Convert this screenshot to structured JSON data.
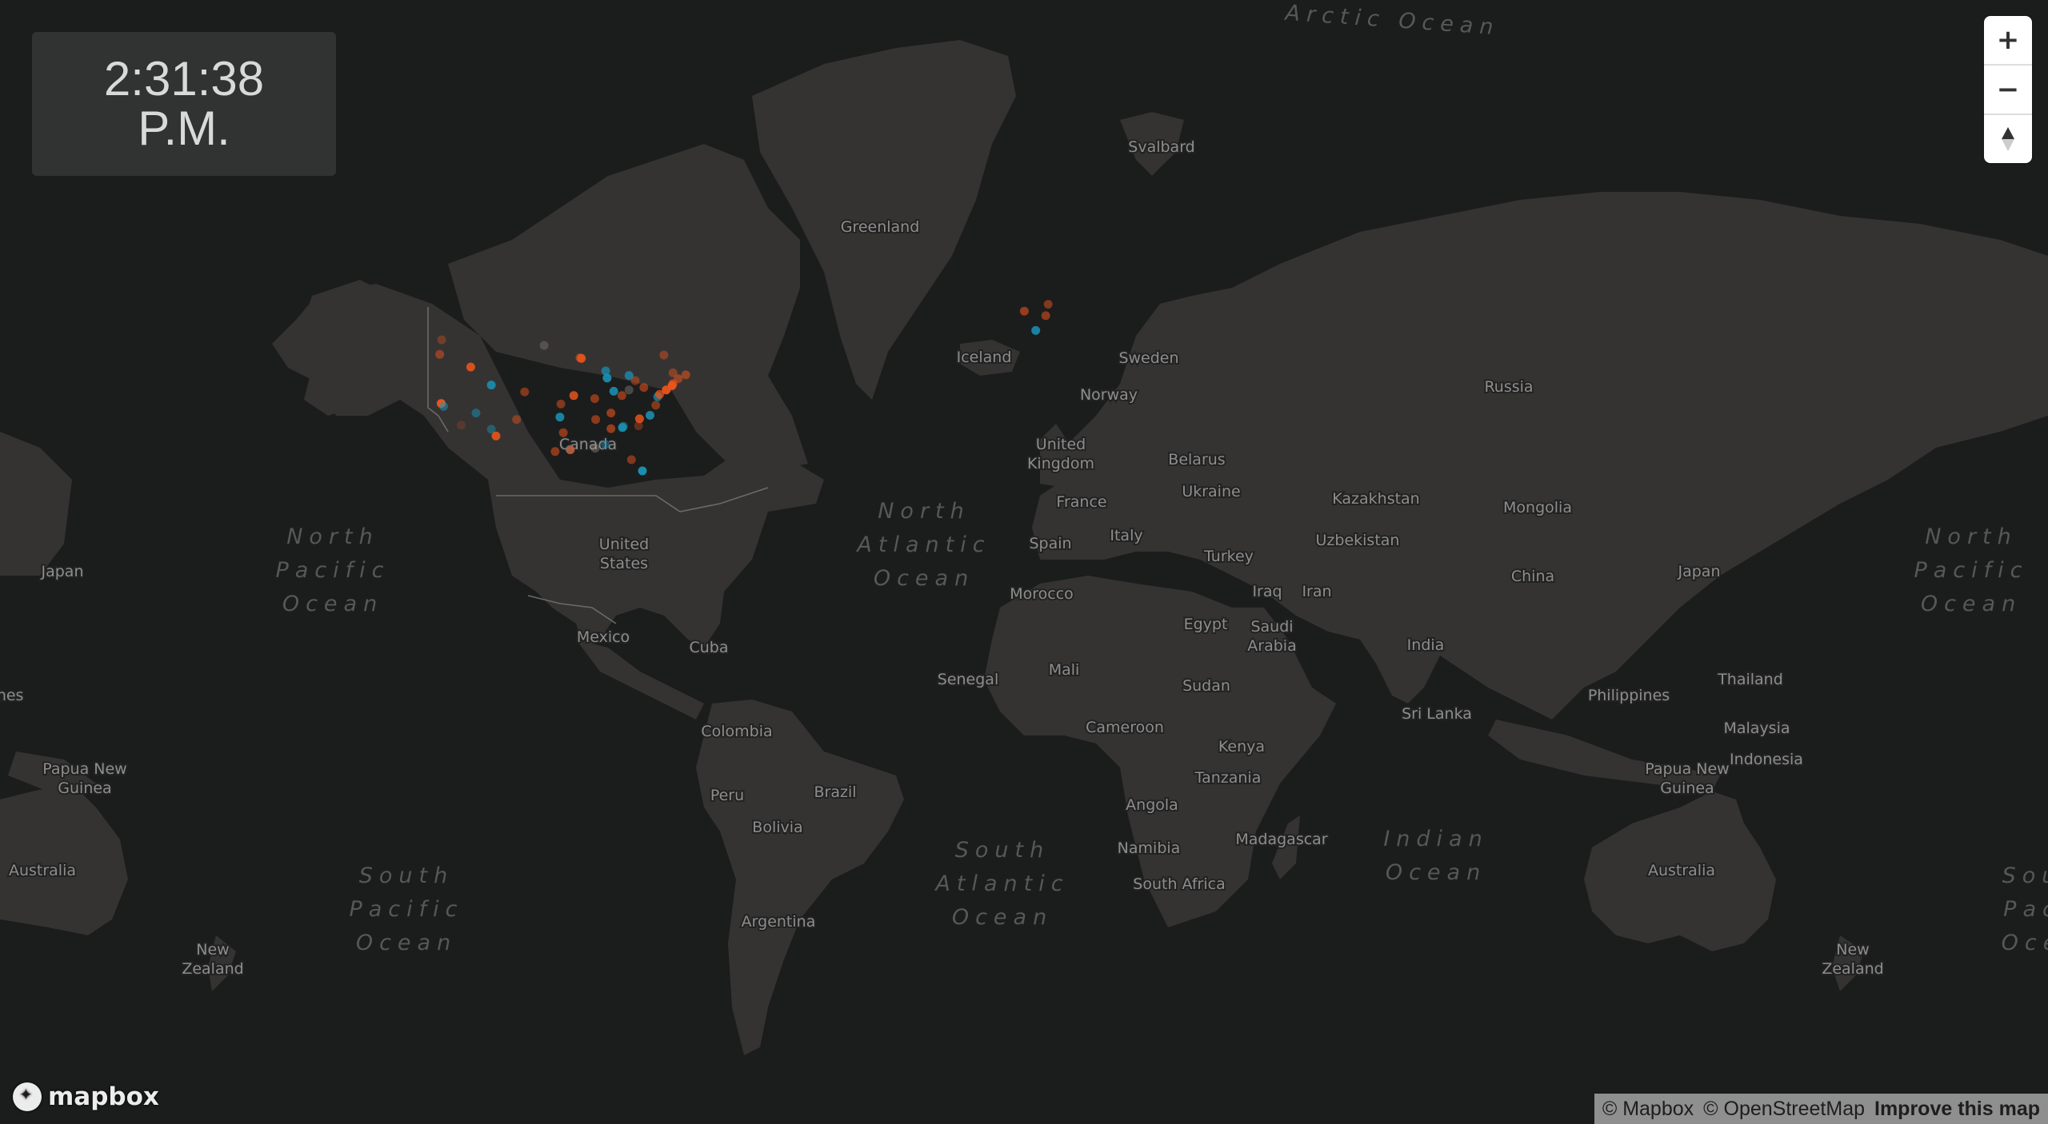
{
  "clock": {
    "time": "2:31:38",
    "period": "P.M."
  },
  "controls": {
    "zoom_in": "+",
    "zoom_out": "−",
    "compass_icon": "compass-north-arrow"
  },
  "logo": {
    "text": "mapbox",
    "icon": "mapbox-logo-icon"
  },
  "attribution": {
    "mapbox": "© Mapbox",
    "osm": "© OpenStreetMap",
    "improve": "Improve this map"
  },
  "colors": {
    "background": "#1b1c1c",
    "land": "#343332",
    "dot_orange": "#e8541c",
    "dot_blue": "#1a93b8"
  },
  "place_labels": [
    [
      "Greenland"
    ],
    [
      "Svalbard"
    ],
    [
      "Iceland"
    ],
    [
      "Sweden"
    ],
    [
      "Norway"
    ],
    [
      "Canada"
    ],
    [
      "United",
      "Kingdom"
    ],
    [
      "Belarus"
    ],
    [
      "Russia"
    ],
    [
      "Ukraine"
    ],
    [
      "France"
    ],
    [
      "Kazakhstan"
    ],
    [
      "Mongolia"
    ],
    [
      "Italy"
    ],
    [
      "Spain"
    ],
    [
      "Uzbekistan"
    ],
    [
      "Turkey"
    ],
    [
      "United",
      "States"
    ],
    [
      "Japan"
    ],
    [
      "Japan"
    ],
    [
      "China"
    ],
    [
      "Iraq"
    ],
    [
      "Iran"
    ],
    [
      "Morocco"
    ],
    [
      "Egypt"
    ],
    [
      "Saudi",
      "Arabia"
    ],
    [
      "Mexico"
    ],
    [
      "India"
    ],
    [
      "Cuba"
    ],
    [
      "Thailand"
    ],
    [
      "Mali"
    ],
    [
      "Senegal"
    ],
    [
      "Sudan"
    ],
    [
      "Philippines"
    ],
    [
      "ines"
    ],
    [
      "Sri Lanka"
    ],
    [
      "Cameroon"
    ],
    [
      "Malaysia"
    ],
    [
      "Colombia"
    ],
    [
      "Kenya"
    ],
    [
      "Indonesia"
    ],
    [
      "Papua New",
      "Guinea"
    ],
    [
      "Papua New",
      "Guinea"
    ],
    [
      "Tanzania"
    ],
    [
      "Brazil"
    ],
    [
      "Peru"
    ],
    [
      "Bolivia"
    ],
    [
      "Angola"
    ],
    [
      "Madagascar"
    ],
    [
      "Namibia"
    ],
    [
      "Australia"
    ],
    [
      "Australia"
    ],
    [
      "South Africa"
    ],
    [
      "Argentina"
    ],
    [
      "New",
      "Zealand"
    ],
    [
      "New",
      "Zealand"
    ]
  ],
  "ocean_labels": [
    [
      "Arctic Ocean"
    ],
    [
      "North",
      "Pacific",
      "Ocean"
    ],
    [
      "North",
      "Atlantic",
      "Ocean"
    ],
    [
      "North",
      "Pacific",
      "Ocean"
    ],
    [
      "South",
      "Pacific",
      "Ocean"
    ],
    [
      "South",
      "Atlantic",
      "Ocean"
    ],
    [
      "Indian",
      "Ocean"
    ],
    [
      "Sou",
      "Pac",
      "Oce"
    ]
  ],
  "data_points": {
    "legend_note": "Orange and blue markers at US and European locations",
    "points": [
      {
        "lon": -122.7,
        "lat": 45.5,
        "color": "orange",
        "opacity": 0.5
      },
      {
        "lon": -122.3,
        "lat": 47.6,
        "color": "orange",
        "opacity": 0.35
      },
      {
        "lon": -116.2,
        "lat": 43.6,
        "color": "orange",
        "opacity": 0.9
      },
      {
        "lon": -122.4,
        "lat": 37.8,
        "color": "orange",
        "opacity": 1.0
      },
      {
        "lon": -118.2,
        "lat": 34.1,
        "color": "orange",
        "opacity": 0.2
      },
      {
        "lon": -121.9,
        "lat": 37.3,
        "color": "blue",
        "opacity": 0.55
      },
      {
        "lon": -111.9,
        "lat": 40.8,
        "color": "blue",
        "opacity": 0.85
      },
      {
        "lon": -115.1,
        "lat": 36.2,
        "color": "blue",
        "opacity": 0.5
      },
      {
        "lon": -111.9,
        "lat": 33.4,
        "color": "blue",
        "opacity": 0.45
      },
      {
        "lon": -110.9,
        "lat": 32.2,
        "color": "orange",
        "opacity": 0.9
      },
      {
        "lon": -106.6,
        "lat": 35.1,
        "color": "orange",
        "opacity": 0.45
      },
      {
        "lon": -104.9,
        "lat": 39.7,
        "color": "orange",
        "opacity": 0.5
      },
      {
        "lon": -100.8,
        "lat": 46.8,
        "color": "white",
        "opacity": 0.25
      },
      {
        "lon": -93.3,
        "lat": 45.0,
        "color": "orange",
        "opacity": 0.5
      },
      {
        "lon": -93.0,
        "lat": 44.9,
        "color": "orange",
        "opacity": 0.9
      },
      {
        "lon": -97.3,
        "lat": 37.7,
        "color": "orange",
        "opacity": 0.5
      },
      {
        "lon": -94.6,
        "lat": 39.1,
        "color": "orange",
        "opacity": 0.85
      },
      {
        "lon": -90.2,
        "lat": 38.6,
        "color": "orange",
        "opacity": 0.55
      },
      {
        "lon": -87.6,
        "lat": 41.9,
        "color": "blue",
        "opacity": 0.9
      },
      {
        "lon": -87.9,
        "lat": 43.0,
        "color": "blue",
        "opacity": 0.7
      },
      {
        "lon": -83.0,
        "lat": 42.3,
        "color": "blue",
        "opacity": 0.75
      },
      {
        "lon": -86.2,
        "lat": 39.8,
        "color": "blue",
        "opacity": 0.85
      },
      {
        "lon": -81.7,
        "lat": 41.5,
        "color": "orange",
        "opacity": 0.45
      },
      {
        "lon": -84.5,
        "lat": 39.1,
        "color": "orange",
        "opacity": 0.55
      },
      {
        "lon": -97.5,
        "lat": 35.5,
        "color": "blue",
        "opacity": 0.85
      },
      {
        "lon": -96.8,
        "lat": 32.8,
        "color": "orange",
        "opacity": 0.55
      },
      {
        "lon": -95.4,
        "lat": 29.8,
        "color": "blue",
        "opacity": 0.7
      },
      {
        "lon": -95.3,
        "lat": 29.7,
        "color": "orange",
        "opacity": 0.7
      },
      {
        "lon": -98.5,
        "lat": 29.4,
        "color": "orange",
        "opacity": 0.55
      },
      {
        "lon": -90.1,
        "lat": 30.0,
        "color": "white",
        "opacity": 0.3
      },
      {
        "lon": -90.0,
        "lat": 35.1,
        "color": "orange",
        "opacity": 0.55
      },
      {
        "lon": -86.8,
        "lat": 36.2,
        "color": "orange",
        "opacity": 0.6
      },
      {
        "lon": -86.8,
        "lat": 33.5,
        "color": "orange",
        "opacity": 0.6
      },
      {
        "lon": -84.4,
        "lat": 33.7,
        "color": "blue",
        "opacity": 0.85
      },
      {
        "lon": -84.2,
        "lat": 33.9,
        "color": "blue",
        "opacity": 0.55
      },
      {
        "lon": -82.5,
        "lat": 27.9,
        "color": "orange",
        "opacity": 0.5
      },
      {
        "lon": -80.2,
        "lat": 25.8,
        "color": "blue",
        "opacity": 0.95
      },
      {
        "lon": -88.0,
        "lat": 30.7,
        "color": "blue",
        "opacity": 0.45
      },
      {
        "lon": -80.8,
        "lat": 35.2,
        "color": "orange",
        "opacity": 0.85
      },
      {
        "lon": -81.0,
        "lat": 34.0,
        "color": "orange",
        "opacity": 0.35
      },
      {
        "lon": -78.6,
        "lat": 35.8,
        "color": "blue",
        "opacity": 0.85
      },
      {
        "lon": -77.4,
        "lat": 37.5,
        "color": "orange",
        "opacity": 0.5
      },
      {
        "lon": -77.0,
        "lat": 38.9,
        "color": "blue",
        "opacity": 0.7
      },
      {
        "lon": -76.6,
        "lat": 39.3,
        "color": "orange",
        "opacity": 0.75
      },
      {
        "lon": -75.2,
        "lat": 40.0,
        "color": "orange",
        "opacity": 0.95
      },
      {
        "lon": -74.0,
        "lat": 40.7,
        "color": "orange",
        "opacity": 1.0
      },
      {
        "lon": -73.8,
        "lat": 41.0,
        "color": "orange",
        "opacity": 0.7
      },
      {
        "lon": -72.7,
        "lat": 41.8,
        "color": "orange",
        "opacity": 0.55
      },
      {
        "lon": -71.1,
        "lat": 42.4,
        "color": "orange",
        "opacity": 0.55
      },
      {
        "lon": -79.9,
        "lat": 40.4,
        "color": "orange",
        "opacity": 0.55
      },
      {
        "lon": -73.8,
        "lat": 42.7,
        "color": "orange",
        "opacity": 0.45
      },
      {
        "lon": -75.7,
        "lat": 45.4,
        "color": "orange",
        "opacity": 0.45
      },
      {
        "lon": -79.4,
        "lat": 43.7,
        "color": "orange",
        "opacity": 0.0
      },
      {
        "lon": -83.0,
        "lat": 40.0,
        "color": "white",
        "opacity": 0.3
      },
      {
        "lon": -0.1,
        "lat": 51.5,
        "color": "orange",
        "opacity": 0.6
      },
      {
        "lon": 4.9,
        "lat": 52.4,
        "color": "orange",
        "opacity": 0.5
      },
      {
        "lon": 4.4,
        "lat": 50.9,
        "color": "orange",
        "opacity": 0.55
      },
      {
        "lon": 2.3,
        "lat": 48.9,
        "color": "blue",
        "opacity": 0.85
      }
    ]
  }
}
